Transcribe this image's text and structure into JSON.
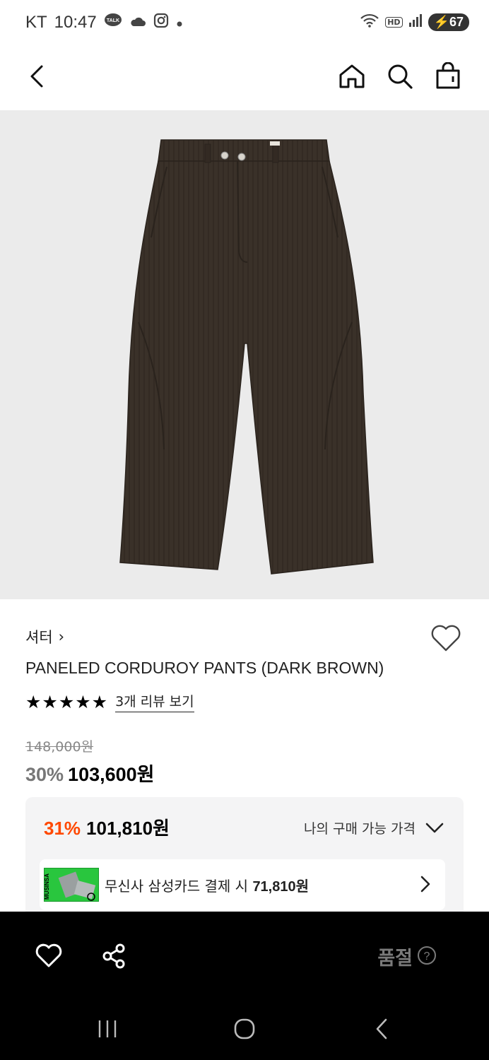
{
  "status_bar": {
    "carrier": "KT",
    "time": "10:47",
    "talk_badge": "TALK",
    "hd_label": "HD",
    "battery": "67"
  },
  "product": {
    "brand": "셔터",
    "brand_chevron": "›",
    "name": "PANELED CORDUROY PANTS (DARK BROWN)",
    "rating_stars": "★★★★★",
    "review_link": "3개 리뷰 보기",
    "original_price": "148,000원",
    "discount_rate": "30%",
    "sale_price": "103,600원"
  },
  "benefit": {
    "best_discount": "31%",
    "best_price": "101,810원",
    "my_price_label": "나의 구매 가능 가격",
    "card_offer_prefix": "무신사 삼성카드 결제 시 ",
    "card_offer_price": "71,810원",
    "card_brand": "MUSINSA"
  },
  "action_bar": {
    "soldout_label": "품절",
    "help_glyph": "?"
  },
  "colors": {
    "accent": "#ff4800",
    "product_bg": "#ebebeb",
    "pants": "#3a3129"
  }
}
